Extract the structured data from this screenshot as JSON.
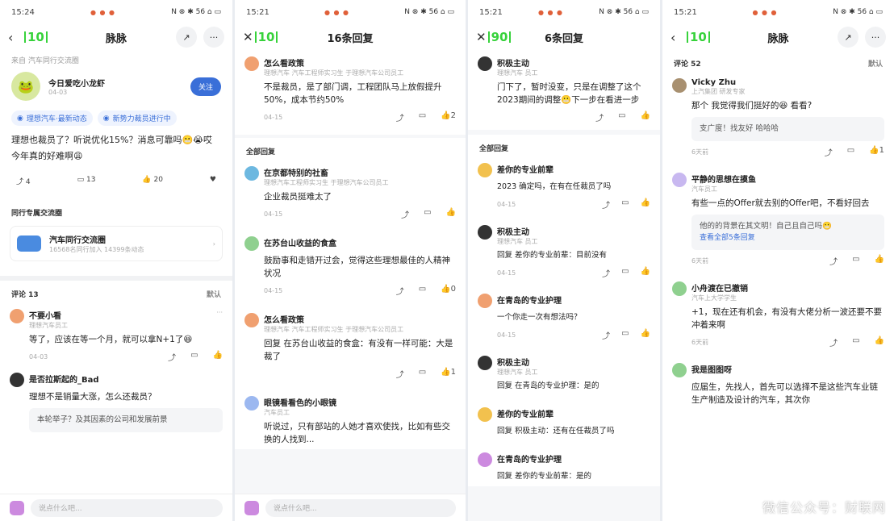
{
  "panels": [
    {
      "status": {
        "time": "15:24",
        "sys": "N ⊗ ✱ 56 ⌂ ▭"
      },
      "nav": {
        "title": "脉脉",
        "logo": "10"
      },
      "post": {
        "crumb": "来自 汽车同行交流圈",
        "author": "今日爱吃小龙虾",
        "date": "04-03",
        "follow": "关注",
        "tags": [
          "理想汽车·最新动态",
          "新势力裁员进行中"
        ],
        "text": "理想也裁员了？听说优化15%？消息可靠吗😬😭哎 今年真的好难啊😩",
        "stats": {
          "share": "4",
          "comment": "13",
          "like": "20"
        }
      },
      "circle": {
        "section": "同行专属交流圈",
        "name": "汽车同行交流圈",
        "meta": "16568名同行加入 14399条动态"
      },
      "comments_header": {
        "title": "评论 13",
        "sort": "默认"
      },
      "comments": [
        {
          "name": "不要小看",
          "sub": "理想汽车员工",
          "text": "等了，应该在等一个月，就可以拿N+1了😆",
          "date": "04-03"
        },
        {
          "name": "是否拉斯起的_Bad",
          "sub": "",
          "text": "理想不是销量大涨，怎么还裁员？",
          "date": "",
          "quote": "本轮举子？及其因素的公司和发展前景"
        }
      ],
      "input": "说点什么吧..."
    },
    {
      "status": {
        "time": "15:21",
        "sys": "N ⊗ ✱ 56 ⌂ ▭"
      },
      "nav": {
        "title": "16条回复",
        "logo": "10"
      },
      "top": {
        "name": "怎么看政策",
        "sub": "理想汽车 汽车工程师实习生 于理想汽车公司员工",
        "text": "不是裁员，是了部门调，工程团队马上放假提升50%，成本节约50%",
        "date": "04-15",
        "likes": "2"
      },
      "section": "全部回复",
      "replies": [
        {
          "name": "在京都特别的社畜",
          "sub": "理想汽车工程师实习生 于理想汽车公司员工",
          "text": "企业裁员挺难太了",
          "date": "04-15",
          "likes": ""
        },
        {
          "name": "在苏台山收益的食盒",
          "sub": "",
          "text": "鼓励事和走错开过会，觉得这些理想最佳的人精神状况",
          "date": "04-15",
          "likes": "0"
        },
        {
          "name": "怎么看政策",
          "sub": "理想汽车 汽车工程师实习生 于理想汽车公司员工",
          "text": "回复 在苏台山收益的食盒：有没有一样可能：大是裁了",
          "date": "",
          "likes": "1"
        },
        {
          "name": "眼镜看看色的小眼镜",
          "sub": "汽车员工",
          "text": "听说过，只有部站的人她才喜欢使找，比如有些交换的人找到...",
          "date": "",
          "likes": ""
        }
      ],
      "input": "说点什么吧..."
    },
    {
      "status": {
        "time": "15:21",
        "sys": "N ⊗ ✱ 56 ⌂ ▭"
      },
      "nav": {
        "title": "6条回复",
        "logo": "90"
      },
      "top": {
        "name": "积极主动",
        "sub": "理想汽车 员工",
        "text": "门下了，暂时没变，只是在调整了这个2023期间的调整😬下一步在看进一步",
        "date": "",
        "likes": ""
      },
      "section": "全部回复",
      "replies": [
        {
          "name": "差你的专业前辈",
          "sub": "",
          "text": "2023 确定吗，在有在任裁员了吗",
          "date": "04-15"
        },
        {
          "name": "积极主动",
          "sub": "理想汽车 员工",
          "text": "回复 差你的专业前辈：目前没有",
          "date": "04-15"
        },
        {
          "name": "在青岛的专业护理",
          "sub": "",
          "text": "一个你走一次有想法吗？",
          "date": "04-15"
        },
        {
          "name": "积极主动",
          "sub": "理想汽车 员工",
          "text": "回复 在青岛的专业护理：是的",
          "date": ""
        },
        {
          "name": "差你的专业前辈",
          "sub": "",
          "text": "回复 积极主动：还有在任裁员了吗",
          "date": ""
        },
        {
          "name": "在青岛的专业护理",
          "sub": "",
          "text": "回复 差你的专业前辈：是的",
          "date": ""
        }
      ]
    },
    {
      "status": {
        "time": "15:21",
        "sys": "N ⊗ ✱ 56 ⌂ ▭"
      },
      "nav": {
        "title": "脉脉",
        "logo": "10"
      },
      "comments_header": {
        "title": "评论 52",
        "sort": "默认"
      },
      "comments": [
        {
          "name": "Vicky Zhu",
          "sub": "上汽集团 研发专家",
          "text": "那个 我觉得我们挺好的😆 看看?",
          "date": "6天前",
          "likes": "1",
          "quote": "支广度！找友好 哈哈哈"
        },
        {
          "name": "平静的思想在摸鱼",
          "sub": "汽车员工",
          "text": "有些一点的Offer就去别的Offer吧，不看好回去",
          "date": "6天前",
          "likes": "",
          "quote": "他的的背景在其文明！自己且自己吗😬",
          "link": "查看全部5条回复"
        },
        {
          "name": "小舟渡在已撤销",
          "sub": "汽车上大学学生",
          "text": "+1，现在还有机会，有没有大佬分析一波还要不要冲着来啊",
          "date": "6天前",
          "likes": ""
        },
        {
          "name": "我是图图呀",
          "sub": "",
          "text": "应届生，先找人，首先可以选择不是这些汽车业链生产制造及设计的汽车，其次你",
          "date": "",
          "likes": ""
        }
      ],
      "watermark": "微信公众号：财联网"
    }
  ]
}
